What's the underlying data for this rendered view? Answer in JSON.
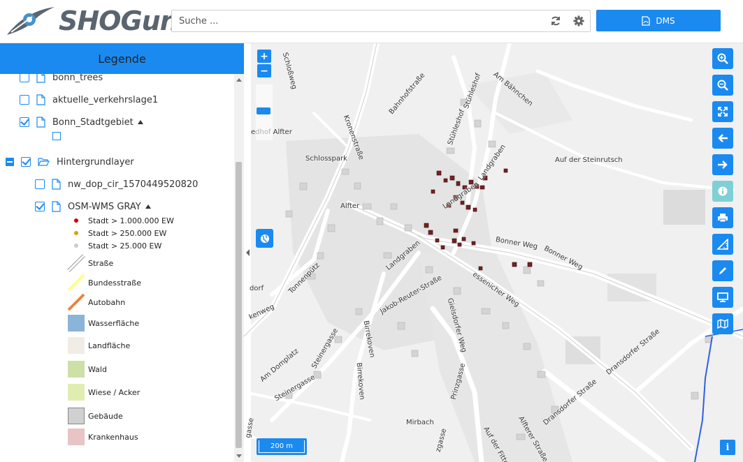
{
  "app": {
    "logo_text": "SHOGun"
  },
  "header": {
    "search_placeholder": "Suche ...",
    "refresh_icon": "refresh-icon",
    "settings_icon": "gear-icon",
    "dms_label": "DMS",
    "accent": "#1a8af0"
  },
  "legend": {
    "title": "Legende",
    "layers": [
      {
        "label": "bonn_trees",
        "checked": false
      },
      {
        "label": "aktuelle_verkehrslage1",
        "checked": false
      },
      {
        "label": "Bonn_Stadtgebiet",
        "checked": true
      },
      {
        "label": "Hintergrundlayer",
        "checked": true
      },
      {
        "label": "nw_dop_cir_1570449520820",
        "checked": false
      },
      {
        "label": "OSM-WMS GRAY",
        "checked": true
      }
    ],
    "items": [
      {
        "label": "Stadt > 1.000.000 EW",
        "color": "#cc0000"
      },
      {
        "label": "Stadt > 250.000 EW",
        "color": "#e0a000"
      },
      {
        "label": "Stadt > 25.000 EW",
        "color": "#cccccc"
      },
      {
        "label": "Straße",
        "color": "#ffffff"
      },
      {
        "label": "Bundesstraße",
        "color": "#ffff80"
      },
      {
        "label": "Autobahn",
        "color": "#f08040"
      },
      {
        "label": "Wasserfläche",
        "color": "#8ab4d8"
      },
      {
        "label": "Landfläche",
        "color": "#f1ede6"
      },
      {
        "label": "Wald",
        "color": "#cde0a8"
      },
      {
        "label": "Wiese / Acker",
        "color": "#e0edb0"
      },
      {
        "label": "Gebäude",
        "color": "#d0d0d0"
      },
      {
        "label": "Krankenhaus",
        "color": "#e8c4c4"
      }
    ]
  },
  "map": {
    "zoom_in": "+",
    "zoom_out": "−",
    "scale_label": "200 m",
    "info_label": "i",
    "labels": {
      "schlossweg": "Schloßweg",
      "kronenstrasse": "Kronenstraße",
      "bahnhofstrasse": "Bahnhofstraße",
      "stuhleshof": "Stühleshof",
      "stuhleshof2": "Stühleshof",
      "am_bahnchen": "Am Bähnchen",
      "sedhof": "edhof Alfter",
      "schlosspark": "Schlosspark",
      "landgraben1": "Landgraben",
      "auf_der_steinrutsch": "Auf der Steinrutsch",
      "alfter": "Alfter",
      "landgraben2": "Landgraben",
      "landgraben3": "Landgraben",
      "bonner_weg1": "Bonner Weg",
      "bonner_weg2": "Bonner Weg",
      "tonnenpuetz": "Tonnenpütz",
      "jakob_reuter": "Jakob-Reuter-Straße",
      "gielsdorfer": "Gielsdorfer Weg",
      "essenicher": "essenicher Weg",
      "birrekoven1": "Birrekoven",
      "birrekoven2": "Birrekoven",
      "am_domplatz": "Am Domplatz",
      "steinergasse1": "Steinergasse",
      "steinergasse2": "Steinergasse",
      "mirbach": "Mirbach",
      "prinzgasse": "Prinzgasse",
      "auf_der_fittel": "Auf der Fittel",
      "alfterer": "Alfterer Straße",
      "dransdorfer": "Dransdorfer Straße",
      "dransdorfer2": "Dransdorfer Straße",
      "dorf": "dorf",
      "kenweg": "kenweg",
      "gasse": "gasse",
      "zgasse": "zgasse"
    }
  },
  "toolbar": {
    "icons": [
      "zoom-in-icon",
      "zoom-out-icon",
      "fullscreen-icon",
      "arrow-left-icon",
      "arrow-right-icon",
      "info-icon",
      "print-icon",
      "measure-icon",
      "pencil-icon",
      "monitor-icon",
      "map-icon"
    ]
  }
}
